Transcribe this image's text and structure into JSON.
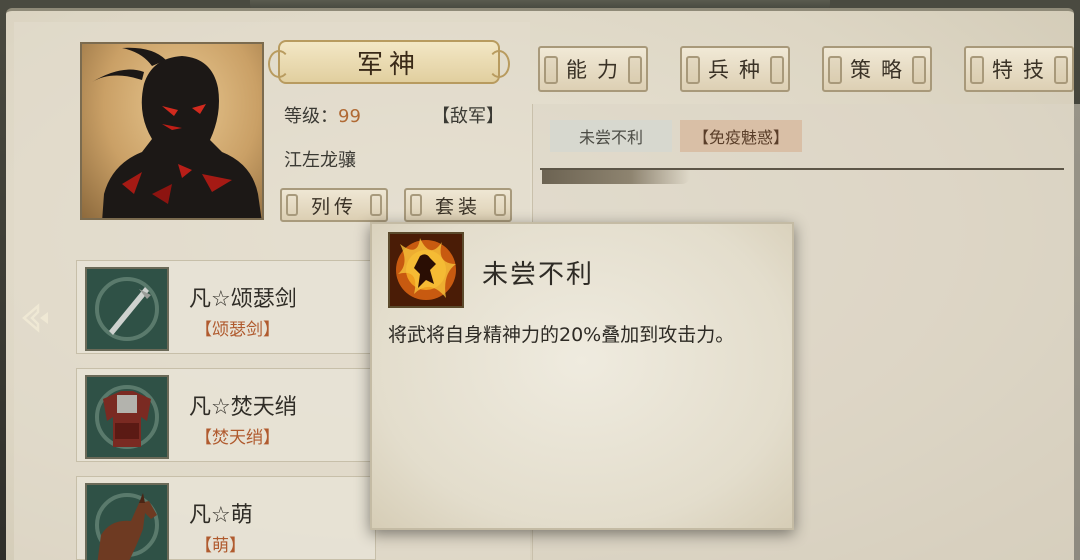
{
  "general": {
    "title": "军神",
    "level_label": "等级：",
    "level_value": "99",
    "faction": "【敌军】",
    "alias": "江左龙骧"
  },
  "buttons": {
    "biography": "列传",
    "equipment_set": "套装"
  },
  "tabs": [
    {
      "label": "能力"
    },
    {
      "label": "兵种"
    },
    {
      "label": "策略"
    },
    {
      "label": "特技"
    }
  ],
  "skill_chips": [
    {
      "label": "未尝不利"
    },
    {
      "label": "【免疫魅惑】"
    }
  ],
  "equipment": [
    {
      "name": "凡☆颂瑟剑",
      "tag": "【颂瑟剑】",
      "icon": "sword-icon"
    },
    {
      "name": "凡☆焚天绡",
      "tag": "【焚天绡】",
      "icon": "armor-icon"
    },
    {
      "name": "凡☆萌",
      "tag": "【萌】",
      "icon": "horse-icon"
    }
  ],
  "tooltip": {
    "title": "未尝不利",
    "description": "将武将自身精神力的20%叠加到攻击力。",
    "icon": "warrior-flame-icon"
  },
  "colors": {
    "paper": "#e5dfcf",
    "level_accent": "#b06a34",
    "tag_accent": "#b05a2e"
  }
}
